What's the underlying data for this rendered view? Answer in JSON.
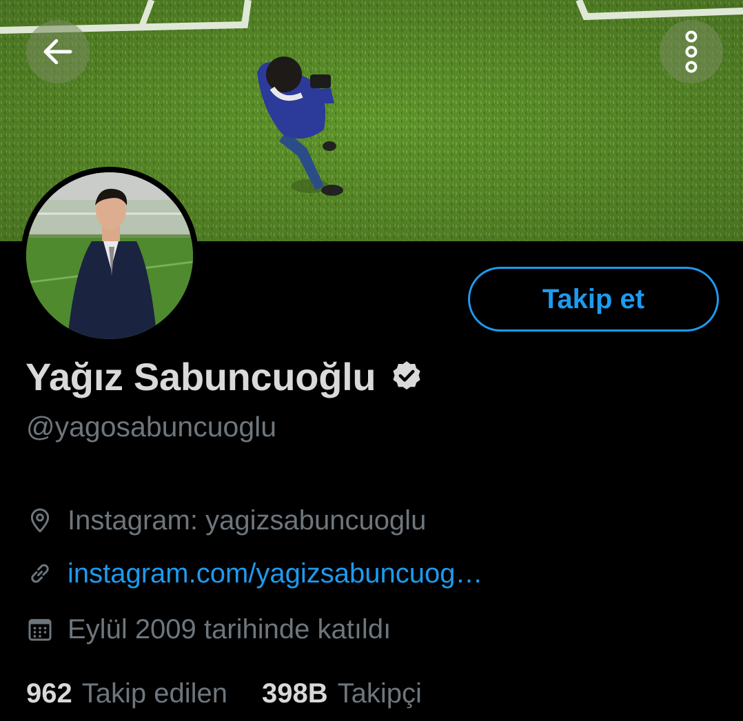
{
  "header": {
    "back_icon": "arrow-left-icon",
    "more_icon": "more-vertical-icon"
  },
  "profile": {
    "display_name": "Yağız Sabuncuoğlu",
    "handle": "@yagosabuncuoglu",
    "verified": true,
    "follow_label": "Takip et",
    "location": "Instagram: yagizsabuncuoglu",
    "website": "instagram.com/yagizsabuncuog…",
    "joined": "Eylül 2009 tarihinde katıldı"
  },
  "stats": {
    "following_count": "962",
    "following_label": "Takip edilen",
    "followers_count": "398B",
    "followers_label": "Takipçi"
  },
  "colors": {
    "background": "#000000",
    "accent": "#1d9bf0",
    "primary_text": "#d9d9d9",
    "secondary_text": "#6e767d"
  }
}
